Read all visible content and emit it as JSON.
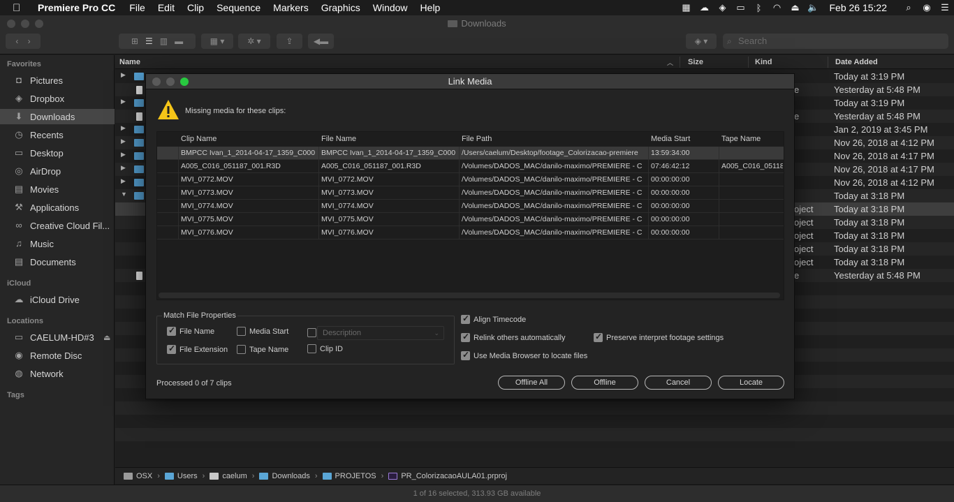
{
  "menubar": {
    "app": "Premiere Pro CC",
    "items": [
      "File",
      "Edit",
      "Clip",
      "Sequence",
      "Markers",
      "Graphics",
      "Window",
      "Help"
    ],
    "clock": "Feb 26  15:22",
    "status_icons": [
      "filmstrip-icon",
      "creative-cloud-icon",
      "dropbox-icon",
      "airplay-icon",
      "bluetooth-icon",
      "wifi-icon",
      "eject-icon",
      "volume-icon",
      "search-icon",
      "siri-icon",
      "list-icon"
    ]
  },
  "finder": {
    "title": "Downloads",
    "search_placeholder": "Search",
    "sidebar": {
      "favorites_label": "Favorites",
      "favorites": [
        {
          "label": "Pictures",
          "icon": "camera-icon"
        },
        {
          "label": "Dropbox",
          "icon": "dropbox-icon"
        },
        {
          "label": "Downloads",
          "icon": "download-icon",
          "selected": true
        },
        {
          "label": "Recents",
          "icon": "clock-icon"
        },
        {
          "label": "Desktop",
          "icon": "desktop-icon"
        },
        {
          "label": "AirDrop",
          "icon": "airdrop-icon"
        },
        {
          "label": "Movies",
          "icon": "film-icon"
        },
        {
          "label": "Applications",
          "icon": "applications-icon"
        },
        {
          "label": "Creative Cloud Fil...",
          "icon": "creative-cloud-icon"
        },
        {
          "label": "Music",
          "icon": "music-icon"
        },
        {
          "label": "Documents",
          "icon": "document-icon"
        }
      ],
      "icloud_label": "iCloud",
      "icloud": [
        {
          "label": "iCloud Drive",
          "icon": "cloud-icon"
        }
      ],
      "locations_label": "Locations",
      "locations": [
        {
          "label": "CAELUM-HD#3",
          "icon": "disk-icon"
        },
        {
          "label": "Remote Disc",
          "icon": "disc-icon"
        },
        {
          "label": "Network",
          "icon": "globe-icon"
        }
      ],
      "tags_label": "Tags"
    },
    "columns": {
      "name": "Name",
      "size": "Size",
      "kind": "Kind",
      "date_added": "Date Added"
    },
    "rows": [
      {
        "type": "folder",
        "disclosure": "▶",
        "kind": "",
        "date": "Today at 3:19 PM"
      },
      {
        "type": "doc",
        "disclosure": "",
        "kind": "e",
        "date": "Yesterday at 5:48 PM"
      },
      {
        "type": "folder",
        "disclosure": "▶",
        "kind": "",
        "date": "Today at 3:19 PM"
      },
      {
        "type": "doc",
        "disclosure": "",
        "kind": "e",
        "date": "Yesterday at 5:48 PM"
      },
      {
        "type": "folder",
        "disclosure": "▶",
        "kind": "",
        "date": "Jan 2, 2019 at 3:45 PM"
      },
      {
        "type": "folder",
        "disclosure": "▶",
        "kind": "",
        "date": "Nov 26, 2018 at 4:12 PM"
      },
      {
        "type": "folder",
        "disclosure": "▶",
        "kind": "",
        "date": "Nov 26, 2018 at 4:17 PM"
      },
      {
        "type": "folder",
        "disclosure": "▶",
        "kind": "",
        "date": "Nov 26, 2018 at 4:17 PM"
      },
      {
        "type": "folder",
        "disclosure": "▶",
        "kind": "",
        "date": "Nov 26, 2018 at 4:12 PM"
      },
      {
        "type": "folder",
        "disclosure": "▼",
        "kind": "",
        "date": "Today at 3:18 PM"
      },
      {
        "type": "none",
        "disclosure": "",
        "kind": "oject",
        "date": "Today at 3:18 PM",
        "selected": true
      },
      {
        "type": "none",
        "disclosure": "",
        "kind": "oject",
        "date": "Today at 3:18 PM"
      },
      {
        "type": "none",
        "disclosure": "",
        "kind": "oject",
        "date": "Today at 3:18 PM"
      },
      {
        "type": "none",
        "disclosure": "",
        "kind": "oject",
        "date": "Today at 3:18 PM"
      },
      {
        "type": "none",
        "disclosure": "",
        "kind": "oject",
        "date": "Today at 3:18 PM"
      },
      {
        "type": "doc",
        "disclosure": "",
        "kind": "e",
        "date": "Yesterday at 5:48 PM"
      }
    ],
    "pathbar": [
      "OSX",
      "Users",
      "caelum",
      "Downloads",
      "PROJETOS",
      "PR_ColorizacaoAULA01.prproj"
    ],
    "status": "1 of 16 selected, 313.93 GB available"
  },
  "dialog": {
    "title": "Link Media",
    "message": "Missing media for these clips:",
    "columns": [
      "Clip Name",
      "File Name",
      "File Path",
      "Media Start",
      "Tape Name"
    ],
    "rows": [
      [
        "BMPCC Ivan_1_2014-04-17_1359_C000",
        "BMPCC Ivan_1_2014-04-17_1359_C000",
        "/Users/caelum/Desktop/footage_Colorizacao-premiere",
        "13:59:34:00",
        ""
      ],
      [
        "A005_C016_051187_001.R3D",
        "A005_C016_051187_001.R3D",
        "/Volumes/DADOS_MAC/danilo-maximo/PREMIERE - C",
        "07:46:42:12",
        "A005_C016_05118"
      ],
      [
        "MVI_0772.MOV",
        "MVI_0772.MOV",
        "/Volumes/DADOS_MAC/danilo-maximo/PREMIERE - C",
        "00:00:00:00",
        ""
      ],
      [
        "MVI_0773.MOV",
        "MVI_0773.MOV",
        "/Volumes/DADOS_MAC/danilo-maximo/PREMIERE - C",
        "00:00:00:00",
        ""
      ],
      [
        "MVI_0774.MOV",
        "MVI_0774.MOV",
        "/Volumes/DADOS_MAC/danilo-maximo/PREMIERE - C",
        "00:00:00:00",
        ""
      ],
      [
        "MVI_0775.MOV",
        "MVI_0775.MOV",
        "/Volumes/DADOS_MAC/danilo-maximo/PREMIERE - C",
        "00:00:00:00",
        ""
      ],
      [
        "MVI_0776.MOV",
        "MVI_0776.MOV",
        "/Volumes/DADOS_MAC/danilo-maximo/PREMIERE - C",
        "00:00:00:00",
        ""
      ]
    ],
    "match_label": "Match File Properties",
    "match": {
      "file_name": {
        "label": "File Name",
        "checked": true
      },
      "media_start": {
        "label": "Media Start",
        "checked": false
      },
      "description": {
        "label": "Description",
        "checked": false
      },
      "file_extension": {
        "label": "File Extension",
        "checked": true
      },
      "tape_name": {
        "label": "Tape Name",
        "checked": false
      },
      "clip_id": {
        "label": "Clip ID",
        "checked": false
      }
    },
    "options": {
      "align_timecode": {
        "label": "Align Timecode",
        "checked": true
      },
      "relink_others": {
        "label": "Relink others automatically",
        "checked": true
      },
      "preserve_interpret": {
        "label": "Preserve interpret footage settings",
        "checked": true
      },
      "media_browser": {
        "label": "Use Media Browser to locate files",
        "checked": true
      }
    },
    "processed": "Processed 0 of 7 clips",
    "buttons": {
      "offline_all": "Offline All",
      "offline": "Offline",
      "cancel": "Cancel",
      "locate": "Locate"
    }
  },
  "colors": {
    "selection": "#464646",
    "folder": "#56a3d6",
    "close": "#ff5f57",
    "minimize": "#ffbd2e",
    "zoom": "#28c940",
    "warning": "#f5c518"
  }
}
